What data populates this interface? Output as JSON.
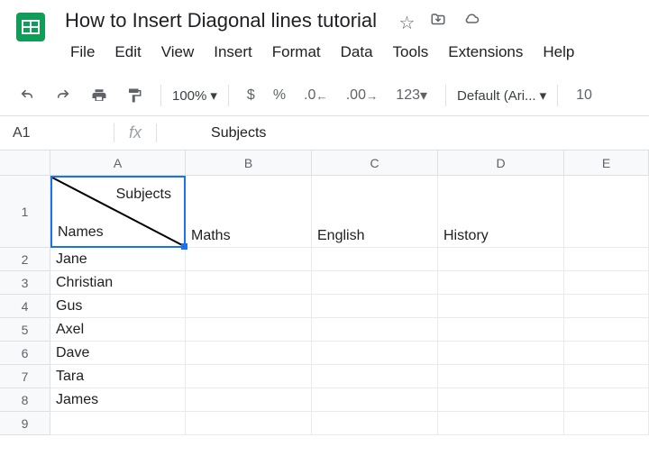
{
  "doc": {
    "title": "How to Insert Diagonal lines tutorial"
  },
  "menus": [
    "File",
    "Edit",
    "View",
    "Insert",
    "Format",
    "Data",
    "Tools",
    "Extensions",
    "Help"
  ],
  "toolbar": {
    "zoom": "100%",
    "currency": "$",
    "percent": "%",
    "dec_minus": ".0",
    "dec_plus": ".00",
    "num_format": "123",
    "font": "Default (Ari...",
    "font_size": "10"
  },
  "namebox": {
    "ref": "A1",
    "fx": "fx",
    "value": "Subjects"
  },
  "columns": [
    "A",
    "B",
    "C",
    "D",
    "E"
  ],
  "rows": [
    "1",
    "2",
    "3",
    "4",
    "5",
    "6",
    "7",
    "8",
    "9"
  ],
  "a1": {
    "top": "Subjects",
    "bottom": "Names"
  },
  "header_row": {
    "B": "Maths",
    "C": "English",
    "D": "History"
  },
  "names": [
    "Jane",
    "Christian",
    "Gus",
    "Axel",
    "Dave",
    "Tara",
    "James"
  ]
}
